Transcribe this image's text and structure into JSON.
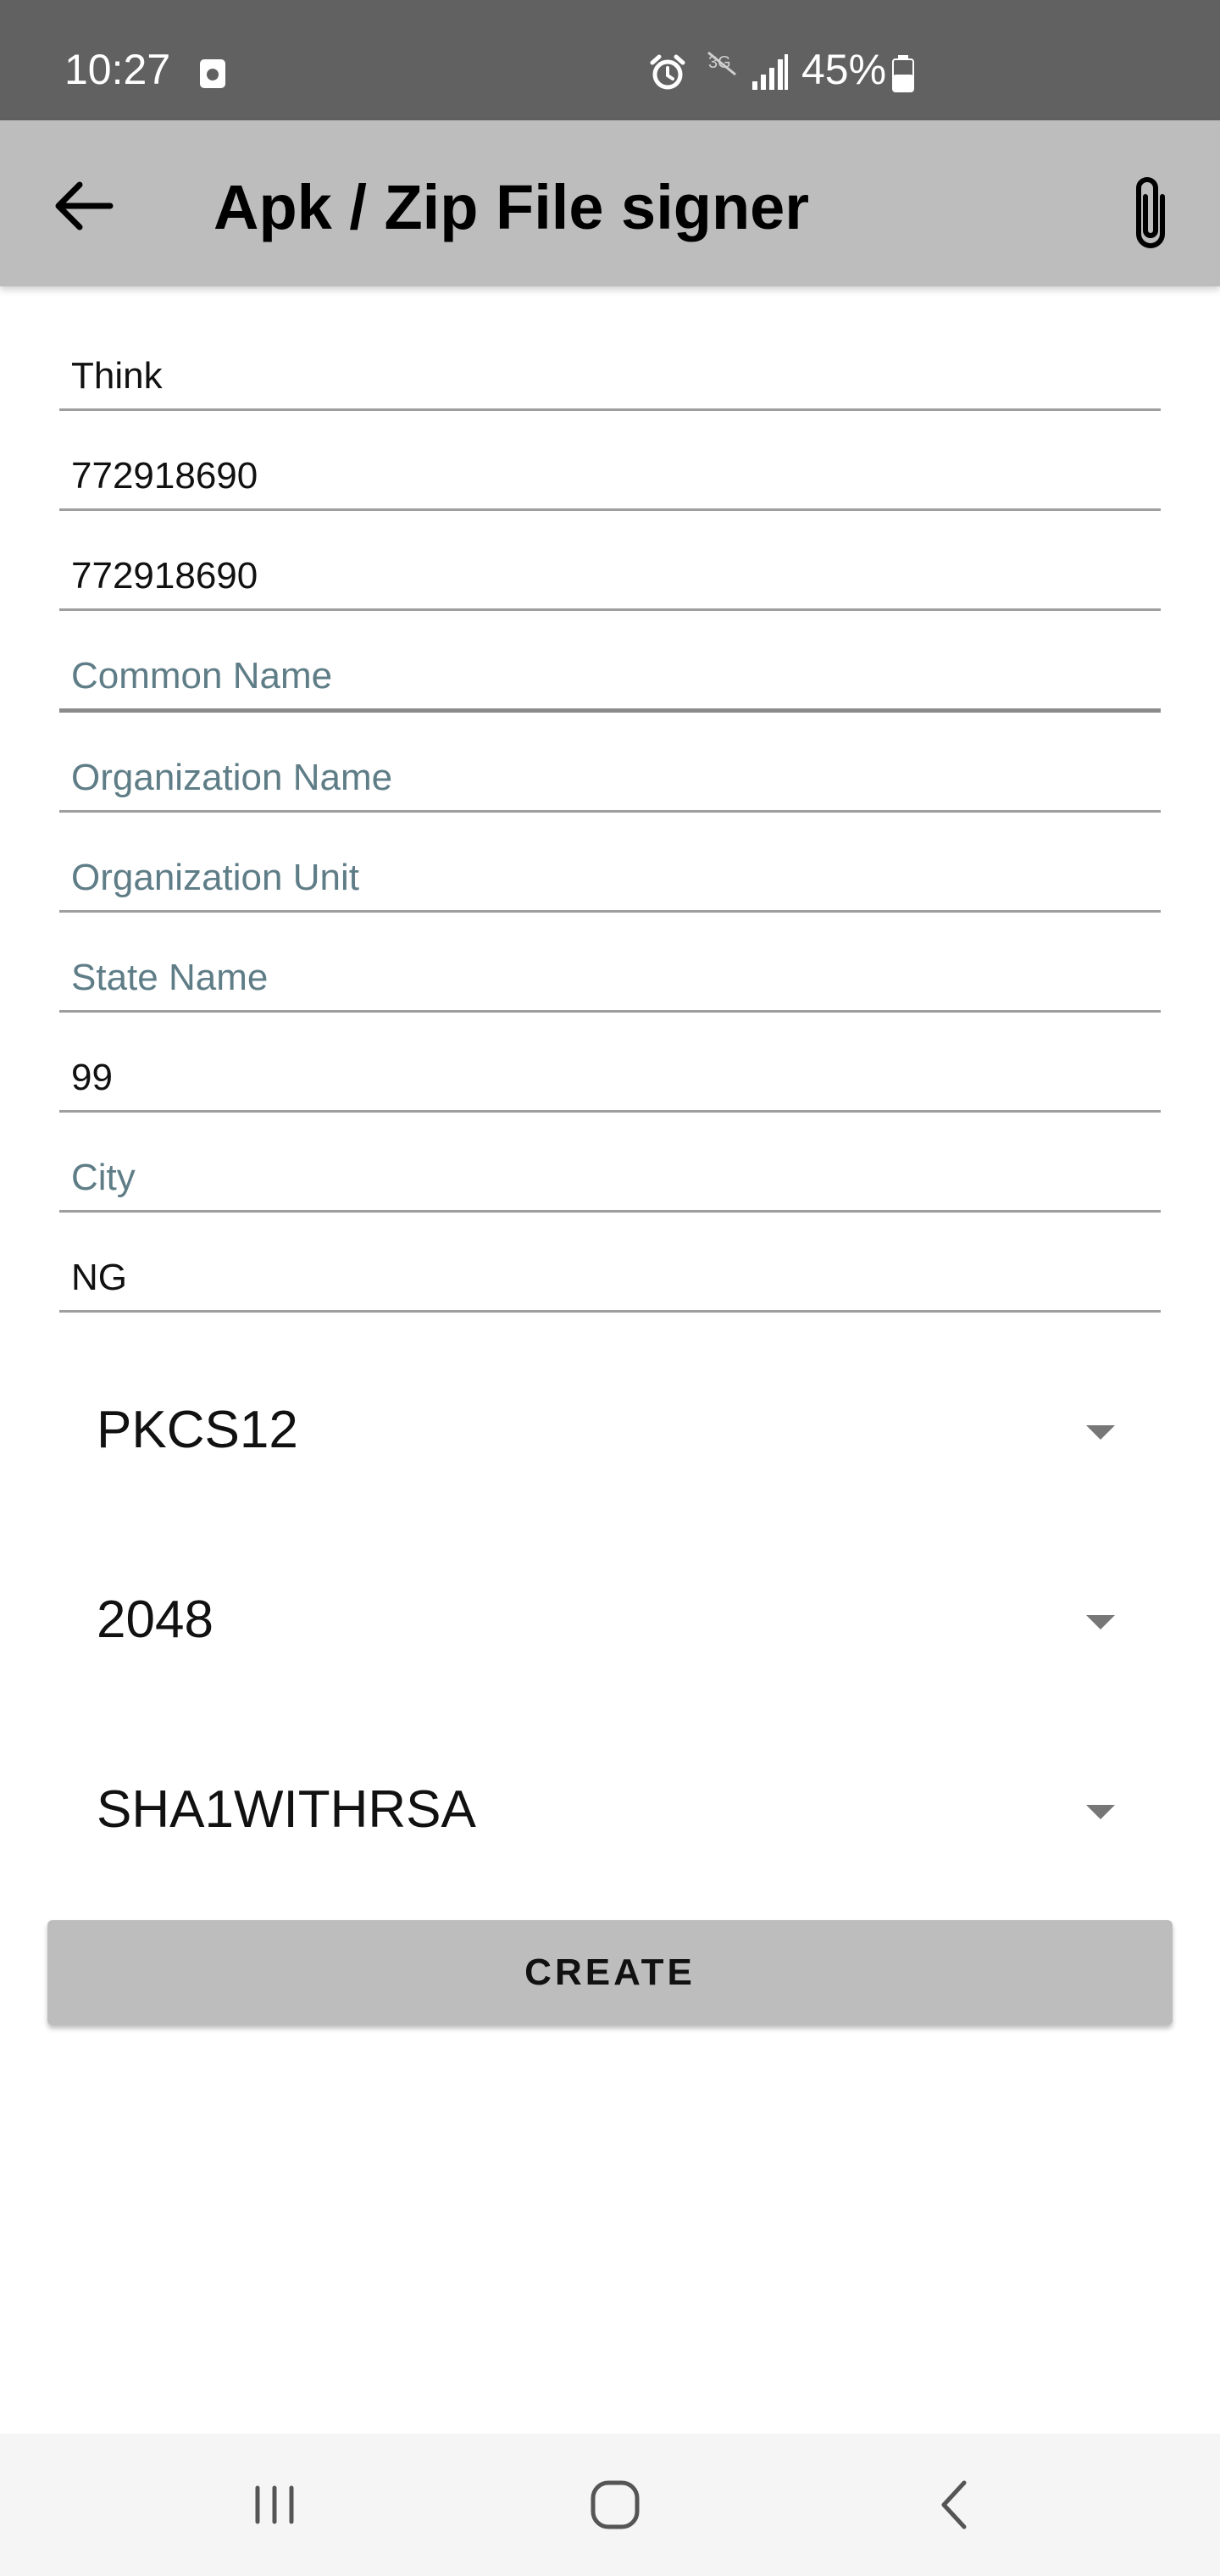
{
  "status_bar": {
    "time": "10:27",
    "battery": "45%",
    "icons": [
      "alarm-clock-icon",
      "signal-icon",
      "battery-icon"
    ]
  },
  "app_bar": {
    "title": "Apk / Zip File signer",
    "back_icon": "arrow-left-icon",
    "attach_icon": "paperclip-icon"
  },
  "form": {
    "fields": [
      {
        "value": "Think",
        "placeholder": ""
      },
      {
        "value": "772918690",
        "placeholder": ""
      },
      {
        "value": "772918690",
        "placeholder": ""
      },
      {
        "value": "",
        "placeholder": "Common Name"
      },
      {
        "value": "",
        "placeholder": "Organization Name"
      },
      {
        "value": "",
        "placeholder": "Organization Unit"
      },
      {
        "value": "",
        "placeholder": "State Name"
      },
      {
        "value": "99",
        "placeholder": ""
      },
      {
        "value": "",
        "placeholder": "City"
      },
      {
        "value": "NG",
        "placeholder": ""
      }
    ],
    "spinners": [
      {
        "value": "PKCS12"
      },
      {
        "value": "2048"
      },
      {
        "value": "SHA1WITHRSA"
      }
    ],
    "create_label": "CREATE"
  },
  "nav_bar": {
    "icons": [
      "recent-apps-icon",
      "home-icon",
      "nav-back-icon"
    ]
  },
  "colors": {
    "status_bar": "#616161",
    "app_bar": "#bdbdbd",
    "placeholder": "#5f7d87",
    "button": "#bdbdbd"
  }
}
